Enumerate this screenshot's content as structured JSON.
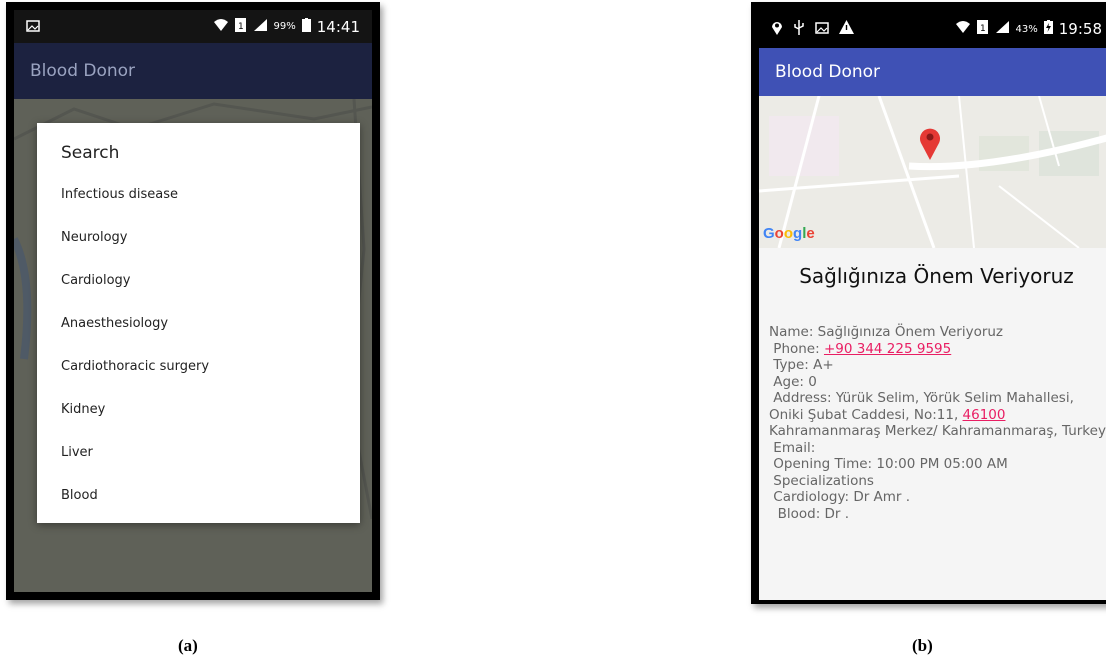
{
  "phone_a": {
    "status": {
      "percent": "99%",
      "time": "14:41"
    },
    "app_title": "Blood Donor",
    "dialog": {
      "title": "Search",
      "items": [
        {
          "label": "Infectious disease"
        },
        {
          "label": "Neurology"
        },
        {
          "label": "Cardiology"
        },
        {
          "label": "Anaesthesiology"
        },
        {
          "label": "Cardiothoracic surgery"
        },
        {
          "label": "Kidney"
        },
        {
          "label": "Liver"
        },
        {
          "label": "Blood"
        }
      ]
    }
  },
  "phone_b": {
    "status": {
      "percent": "43%",
      "time": "19:58"
    },
    "app_title": "Blood Donor",
    "map_logo": "Google",
    "place_title": "Sağlığınıza Önem Veriyoruz",
    "details": {
      "name": "Name: Sağlığınıza Önem Veriyoruz",
      "phone_label": "Phone:",
      "phone_value": "+90 344 225 9595",
      "type": "Type: A+",
      "age": "Age: 0",
      "address_prefix": "Address: Yürük Selim, Yörük Selim Mahallesi, Oniki Şubat Caddesi, No:11,",
      "postal_code": "46100",
      "address_suffix": "Kahramanmaraş Merkez/ Kahramanmaraş, Turkey",
      "email": "Email:",
      "opening_time": "Opening Time: 10:00 PM 05:00 AM",
      "specializations": "Specializations",
      "cardiology": "Cardiology: Dr Amr .",
      "blood": "Blood: Dr ."
    }
  },
  "captions": {
    "a": "(a)",
    "b": "(b)"
  },
  "colors": {
    "appbar_dark": "#1c2240",
    "appbar_primary": "#3f51b5",
    "link": "#e91e63",
    "pin": "#e53935"
  }
}
